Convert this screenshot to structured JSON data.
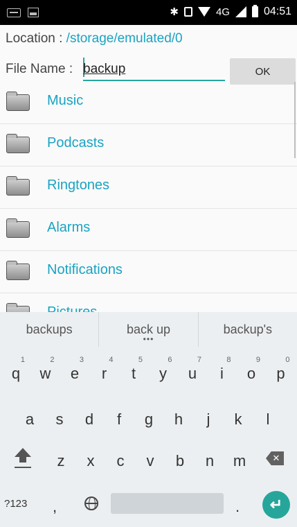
{
  "status_bar": {
    "time": "04:51",
    "network": "4G",
    "bluetooth_icon": "bluetooth-icon",
    "vibrate_icon": "vibrate-icon",
    "wifi_icon": "wifi-icon",
    "signal_icon": "signal-icon",
    "battery_icon": "battery-icon"
  },
  "location": {
    "label": "Location : ",
    "path": "/storage/emulated/0"
  },
  "file_name": {
    "label": "File Name : ",
    "value": "backup"
  },
  "ok_button": {
    "label": "OK"
  },
  "folders": [
    {
      "name": "Music"
    },
    {
      "name": "Podcasts"
    },
    {
      "name": "Ringtones"
    },
    {
      "name": "Alarms"
    },
    {
      "name": "Notifications"
    },
    {
      "name": "Pictures"
    }
  ],
  "keyboard": {
    "suggestions": [
      "backups",
      "back up",
      "backup's"
    ],
    "more_indicator": "•••",
    "row1": [
      {
        "key": "q",
        "hint": "1"
      },
      {
        "key": "w",
        "hint": "2"
      },
      {
        "key": "e",
        "hint": "3"
      },
      {
        "key": "r",
        "hint": "4"
      },
      {
        "key": "t",
        "hint": "5"
      },
      {
        "key": "y",
        "hint": "6"
      },
      {
        "key": "u",
        "hint": "7"
      },
      {
        "key": "i",
        "hint": "8"
      },
      {
        "key": "o",
        "hint": "9"
      },
      {
        "key": "p",
        "hint": "0"
      }
    ],
    "row2": [
      "a",
      "s",
      "d",
      "f",
      "g",
      "h",
      "j",
      "k",
      "l"
    ],
    "row3": [
      "z",
      "x",
      "c",
      "v",
      "b",
      "n",
      "m"
    ],
    "bottom": {
      "symbols": "?123",
      "comma": ",",
      "period": "."
    },
    "accent_color": "#26a69a"
  }
}
